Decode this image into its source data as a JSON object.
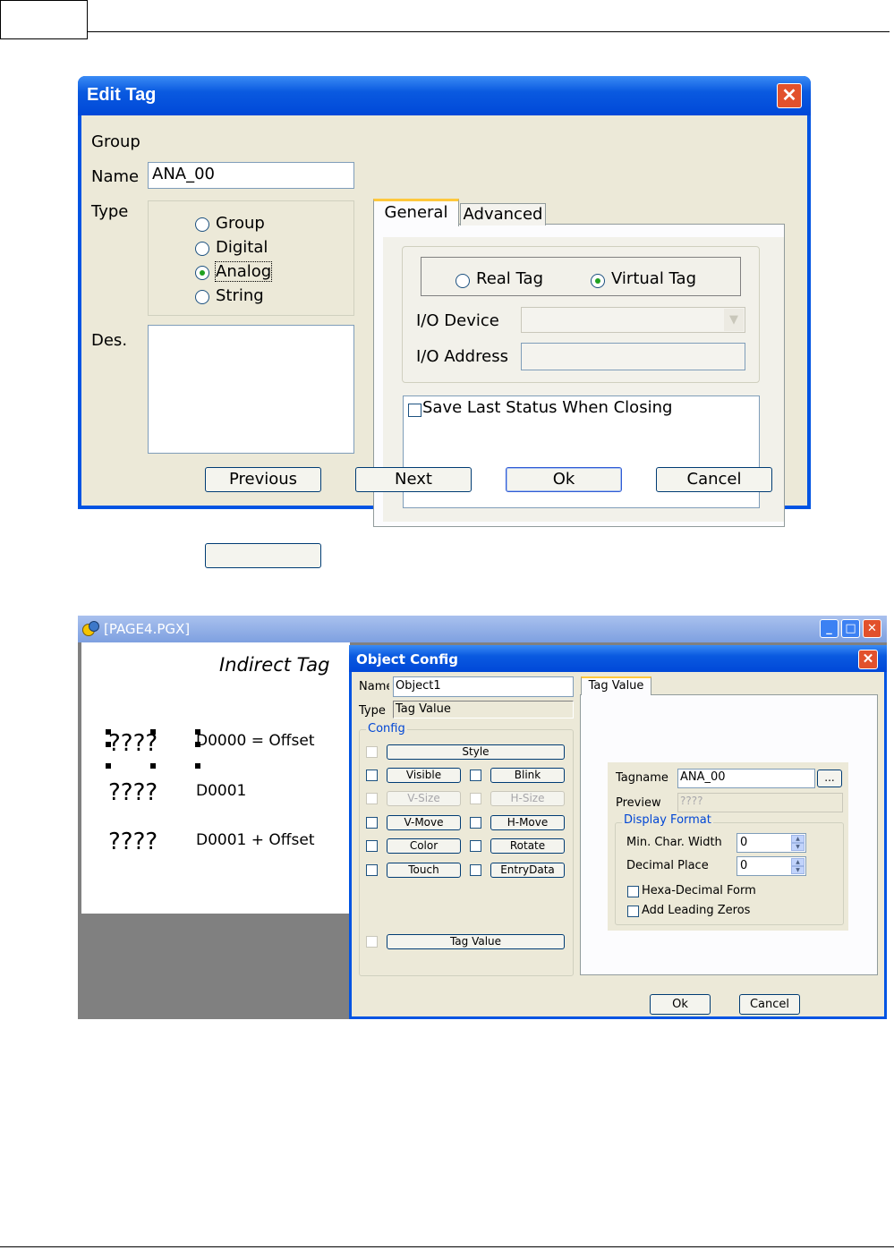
{
  "edit_tag": {
    "title": "Edit Tag",
    "close": "✕",
    "labels": {
      "group": "Group",
      "name": "Name",
      "type": "Type",
      "des": "Des."
    },
    "name_value": "ANA_00",
    "type_options": [
      {
        "label": "Group",
        "selected": false
      },
      {
        "label": "Digital",
        "selected": false
      },
      {
        "label": "Analog",
        "selected": true
      },
      {
        "label": "String",
        "selected": false
      }
    ],
    "tabs": [
      "General",
      "Advanced"
    ],
    "tag_kind": [
      {
        "label": "Real Tag",
        "selected": false
      },
      {
        "label": "Virtual Tag",
        "selected": true
      }
    ],
    "io_device_label": "I/O Device",
    "io_address_label": "I/O Address",
    "save_last_status": "Save Last Status When Closing",
    "buttons": {
      "previous": "Previous",
      "next": "Next",
      "ok": "Ok",
      "cancel": "Cancel"
    }
  },
  "page_window": {
    "title": "[PAGE4.PGX]",
    "canvas_title": "Indirect Tag",
    "rows": [
      {
        "value": "????",
        "label": "D0000 = Offset"
      },
      {
        "value": "????",
        "label": "D0001"
      },
      {
        "value": "????",
        "label": "D0001 + Offset"
      }
    ],
    "window_buttons": {
      "minimize": "_",
      "maximize": "□",
      "close": "✕"
    }
  },
  "object_config": {
    "title": "Object Config",
    "close": "✕",
    "name_label": "Name",
    "name_value": "Object1",
    "type_label": "Type",
    "type_value": "Tag Value",
    "config_label": "Config",
    "config_buttons": {
      "style": "Style",
      "visible": "Visible",
      "blink": "Blink",
      "vsize": "V-Size",
      "hsize": "H-Size",
      "vmove": "V-Move",
      "hmove": "H-Move",
      "color": "Color",
      "rotate": "Rotate",
      "touch": "Touch",
      "entrydata": "EntryData",
      "tagvalue": "Tag Value"
    },
    "tab": "Tag Value",
    "tagname_label": "Tagname",
    "tagname_value": "ANA_00",
    "browse": "...",
    "preview_label": "Preview",
    "preview_value": "????",
    "display_format_label": "Display Format",
    "min_char_width_label": "Min. Char. Width",
    "min_char_width_value": "0",
    "decimal_place_label": "Decimal Place",
    "decimal_place_value": "0",
    "hexa_label": "Hexa-Decimal Form",
    "leading_zeros_label": "Add Leading Zeros",
    "ok": "Ok",
    "cancel": "Cancel"
  }
}
